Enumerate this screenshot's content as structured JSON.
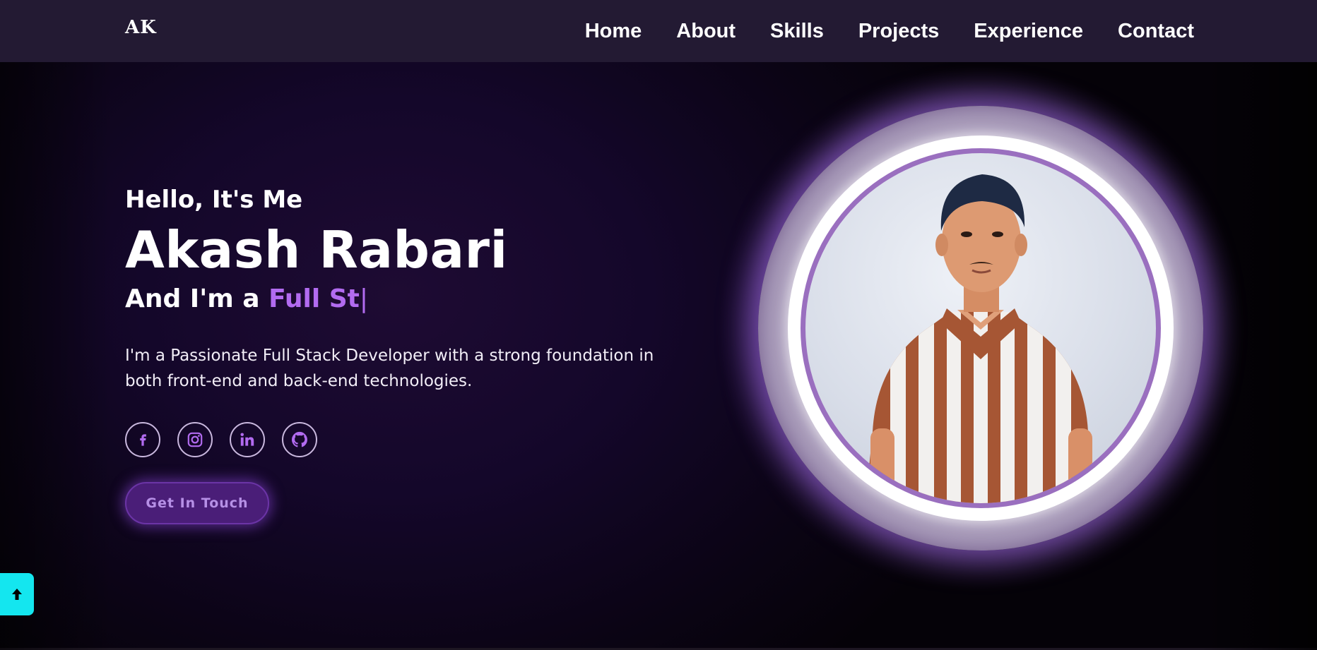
{
  "header": {
    "logo": "AK",
    "nav": [
      {
        "label": "Home"
      },
      {
        "label": "About"
      },
      {
        "label": "Skills"
      },
      {
        "label": "Projects"
      },
      {
        "label": "Experience"
      },
      {
        "label": "Contact"
      }
    ]
  },
  "hero": {
    "greeting": "Hello, It's Me",
    "name": "Akash Rabari",
    "role_prefix": "And I'm a ",
    "role_typed": "Full St",
    "caret": "|",
    "intro": "I'm a Passionate Full Stack Developer with a strong foundation in both front-end and back-end technologies.",
    "socials": [
      {
        "icon": "facebook-icon"
      },
      {
        "icon": "instagram-icon"
      },
      {
        "icon": "linkedin-icon"
      },
      {
        "icon": "github-icon"
      }
    ],
    "cta_label": "Get In Touch"
  },
  "portrait": {
    "icon": "profile-photo"
  },
  "scroll_top": {
    "icon": "arrow-up-icon"
  },
  "colors": {
    "accent": "#b26bf0",
    "nav_bg": "#231a33",
    "cta_bg": "#4a1e78",
    "scroll_top_bg": "#14e6ef"
  }
}
